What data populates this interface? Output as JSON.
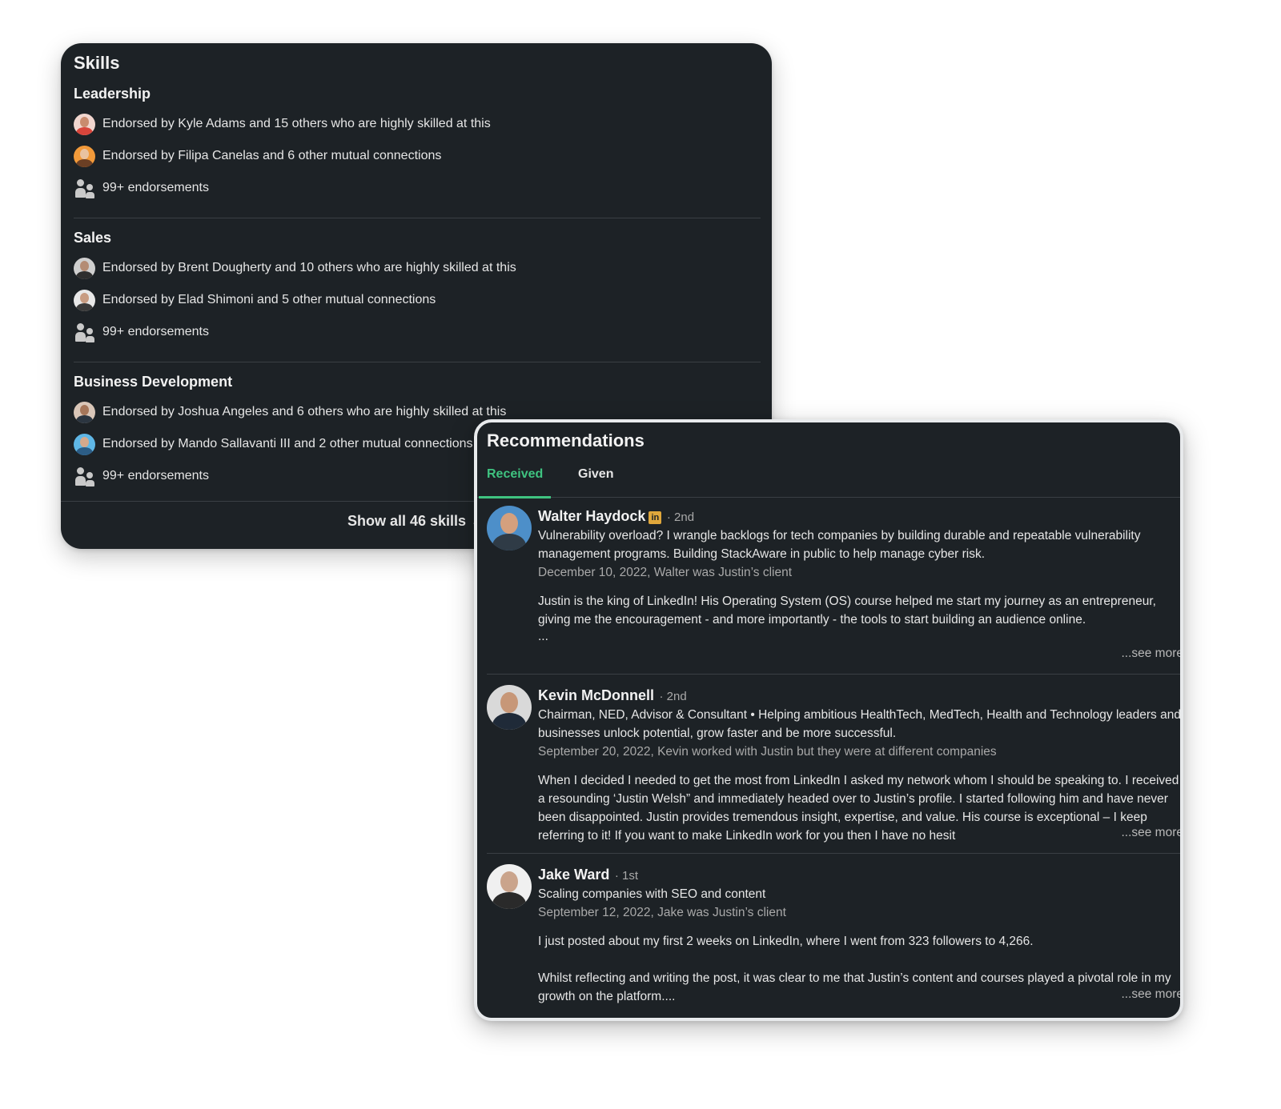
{
  "skills": {
    "title": "Skills",
    "groups": [
      {
        "name": "Leadership",
        "endorsements": [
          "Endorsed by Kyle Adams and 15 others who are highly skilled at this",
          "Endorsed by Filipa Canelas and 6 other mutual connections"
        ],
        "count": "99+ endorsements"
      },
      {
        "name": "Sales",
        "endorsements": [
          "Endorsed by Brent Dougherty and 10 others who are highly skilled at this",
          "Endorsed by Elad Shimoni and 5 other mutual connections"
        ],
        "count": "99+ endorsements"
      },
      {
        "name": "Business Development",
        "endorsements": [
          "Endorsed by Joshua Angeles and 6 others who are highly skilled at this",
          "Endorsed by Mando Sallavanti III and 2 other mutual connections"
        ],
        "count": "99+ endorsements"
      }
    ],
    "show_all": "Show all 46 skills",
    "show_all_arrow": "→"
  },
  "recommendations": {
    "title": "Recommendations",
    "tabs": [
      "Received",
      "Given"
    ],
    "active_tab": "Received",
    "items": [
      {
        "name": "Walter Haydock",
        "badge": "in",
        "degree": "· 2nd",
        "headline": "Vulnerability overload? I wrangle backlogs for tech companies by building durable and repeatable vulnerability management programs. Building StackAware in public to help manage cyber risk.",
        "meta": "December 10, 2022, Walter was Justin’s client",
        "text": [
          "Justin is the king of LinkedIn! His Operating System (OS) course helped me start my journey as an entrepreneur, giving me the encouragement - and more importantly - the tools to start building an audience online."
        ],
        "ellipsis": "...",
        "see_more": "...see more"
      },
      {
        "name": "Kevin McDonnell",
        "degree": "· 2nd",
        "headline": "Chairman, NED, Advisor & Consultant • Helping ambitious HealthTech, MedTech, Health and Technology leaders and businesses unlock potential, grow faster and be more successful.",
        "meta": "September 20, 2022, Kevin worked with Justin but they were at different companies",
        "text": [
          "When I decided I needed to get the most from LinkedIn I asked my network whom I should be speaking to. I received a resounding ‘Justin Welsh” and immediately headed over to Justin’s profile. I started following him and have never been disappointed. Justin provides tremendous insight, expertise, and value. His course is exceptional – I keep referring to it! If you want to make LinkedIn work for you then I have no hesit"
        ],
        "see_more": "...see more"
      },
      {
        "name": "Jake Ward",
        "degree": "· 1st",
        "headline": "Scaling companies with SEO and content",
        "meta": "September 12, 2022, Jake was Justin’s client",
        "text": [
          "I just posted about my first 2 weeks on LinkedIn, where I went from 323 followers to 4,266.",
          "Whilst reflecting and writing the post, it was clear to me that Justin’s content and courses played a pivotal role in my growth on the platform...."
        ],
        "see_more": "...see more"
      }
    ]
  },
  "colors": {
    "card_bg": "#1d2226",
    "accent_green": "#3fc380",
    "linkedin_badge": "#e0a73b"
  },
  "icons": [
    "people-icon",
    "arrow-right-icon",
    "linkedin-badge-icon"
  ]
}
